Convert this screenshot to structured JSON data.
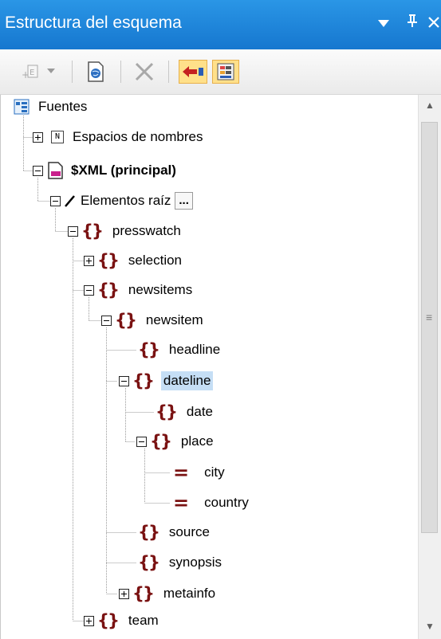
{
  "window": {
    "title": "Estructura del esquema",
    "dropdown_icon": "triangle-down-icon",
    "pin_icon": "pin-icon",
    "close_icon": "close-icon",
    "accent": "#1f87d9"
  },
  "toolbar": {
    "tools": [
      "add-element-icon",
      "dropdown-icon",
      "global-resource-icon",
      "delete-icon",
      "synchronize-icon",
      "show-structure-icon"
    ],
    "active_color": "#ffe08a"
  },
  "tree": {
    "fuentes": "Fuentes",
    "espacios": "Espacios de nombres",
    "espacios_icon": "N",
    "xml": "$XML (principal)",
    "elementos_raiz": "Elementos raíz",
    "more_button": "...",
    "presswatch": "presswatch",
    "selection": "selection",
    "newsitems": "newsitems",
    "newsitem": "newsitem",
    "headline": "headline",
    "dateline": "dateline",
    "date": "date",
    "place": "place",
    "city": "city",
    "country": "country",
    "source": "source",
    "synopsis": "synopsis",
    "metainfo": "metainfo",
    "team": "team",
    "element_glyph": "{}",
    "attribute_glyph": "=",
    "selected_item": "dateline"
  },
  "scrollbar": {
    "up_arrow": "▲",
    "down_arrow": "▼",
    "grip": "≡"
  }
}
